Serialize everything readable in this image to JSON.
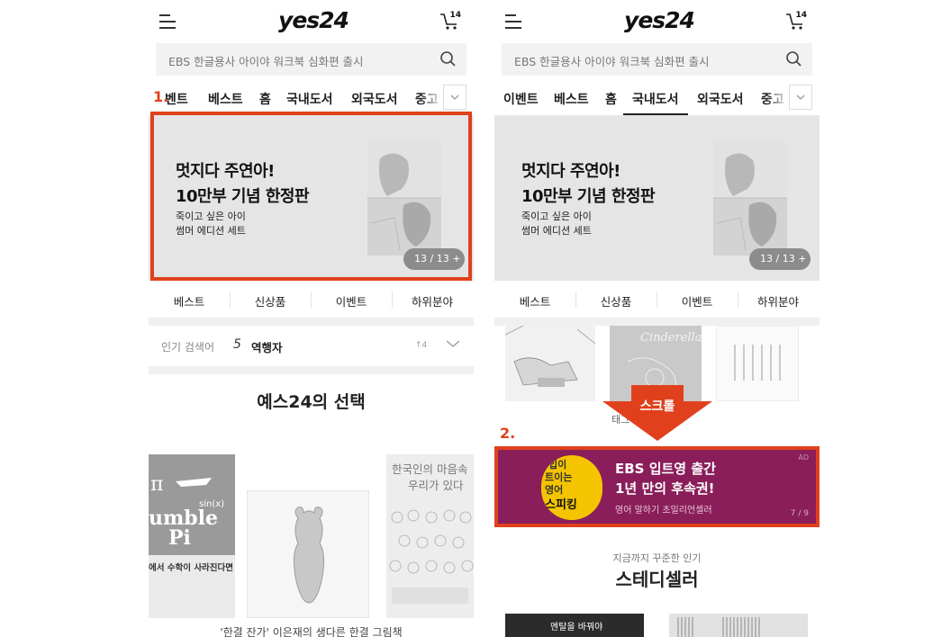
{
  "app": {
    "logo": "yes24",
    "cart_count": "14"
  },
  "search": {
    "placeholder": "EBS 한글용사 아이야 워크북 심화편 출시"
  },
  "tabs": [
    "이벤트",
    "베스트",
    "홈",
    "국내도서",
    "외국도서",
    "중고"
  ],
  "tabs_cut": [
    "벤트",
    "베스트",
    "홈",
    "국내도서",
    "외국도서",
    "중고"
  ],
  "steps": {
    "one": "1.",
    "two": "2."
  },
  "banner": {
    "title_line1": "멋지다 주연아!",
    "title_line2": "10만부 기념 한정판",
    "sub_line1": "죽이고 싶은 아이",
    "sub_line2": "썸머 에디션 세트",
    "counter": "13 / 13 +"
  },
  "categories": [
    "베스트",
    "신상품",
    "이벤트",
    "하위분야"
  ],
  "popular": {
    "label": "인기 검색어",
    "rank": "5",
    "keyword": "역행자",
    "change": "↑4"
  },
  "section_title": "예스24의 선택",
  "book_left": {
    "line1": "umble",
    "line2": "Pi",
    "caption": "에서 수학이 사라진다면"
  },
  "book_right": {
    "line1": "한국인의 마음속",
    "line2": "우리가 있다"
  },
  "bottom_caption": "'한결 잔가' 이은재의 생다른 한결 그림책",
  "phone2": {
    "covers": [
      "Cinderella"
    ],
    "tablink": "태그 더보기 >",
    "scroll_label": "스크롤",
    "ad": {
      "line1": "EBS 입트영 출간",
      "line2": "1년 만의 후속권!",
      "line3": "영어 말하기 초밀리언셀러",
      "badge": "AD",
      "page": "7 / 9",
      "book_text": [
        "입이",
        "트이는",
        "영어",
        "스피킹"
      ]
    },
    "sub_heading": "지금까지 꾸준한 인기",
    "heading": "스테디셀러",
    "bottom_book": "멘탈을 바꿔야"
  },
  "colors": {
    "accent": "#e0411c",
    "ad_bg": "#8a1e5a",
    "banner_bg": "#e5e5e5"
  }
}
